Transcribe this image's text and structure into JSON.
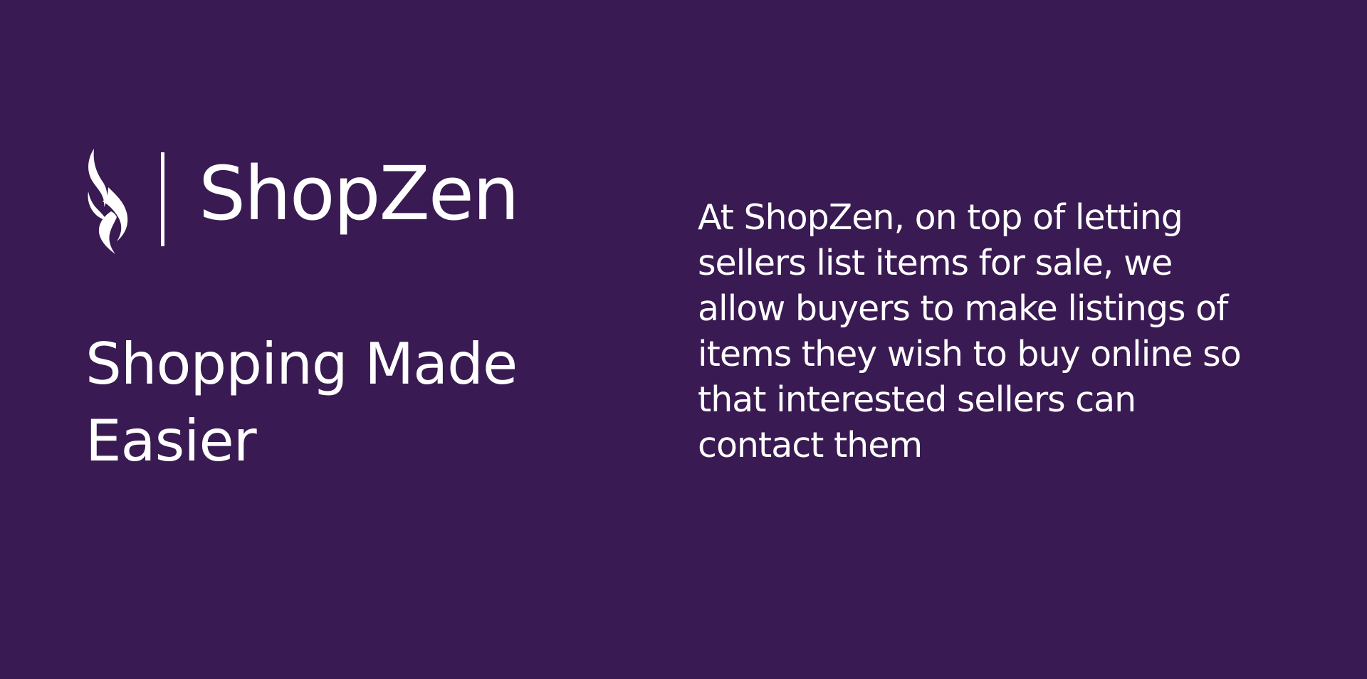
{
  "brand": {
    "name": "ShopZen",
    "logo_icon": "flame-icon"
  },
  "tagline": {
    "lines": [
      "Shopping Made",
      "Easier"
    ]
  },
  "description": {
    "lines": [
      "At ShopZen, on top of letting",
      "sellers list items for sale, we",
      "allow buyers to make listings of",
      "items they wish to buy online so",
      "that interested sellers can",
      "contact them"
    ]
  },
  "colors": {
    "background": "#3a1a52",
    "text": "#ffffff"
  }
}
